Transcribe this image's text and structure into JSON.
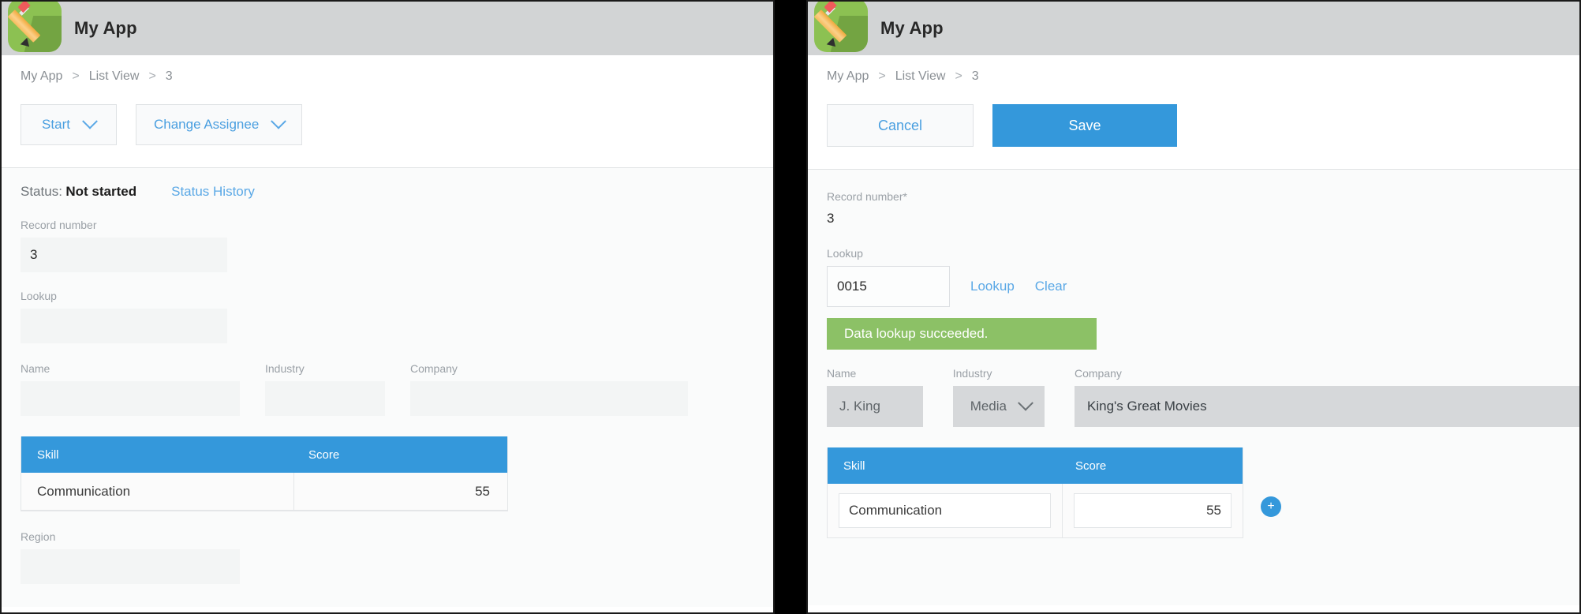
{
  "app": {
    "title": "My App",
    "icon": "pencil-app-icon"
  },
  "breadcrumb": {
    "items": [
      "My App",
      "List View",
      "3"
    ],
    "separator": ">"
  },
  "colors": {
    "accent_blue": "#3498db",
    "link_blue": "#5aa8e6",
    "success_green": "#8cc166",
    "header_gray": "#d2d4d5",
    "field_gray": "#d6d8da",
    "field_flat": "#f3f5f5"
  },
  "left_panel": {
    "toolbar": {
      "start_label": "Start",
      "change_assignee_label": "Change Assignee",
      "chevron_icon": "chevron-down-icon"
    },
    "status": {
      "label": "Status:",
      "value": "Not started",
      "history_link": "Status History"
    },
    "fields": {
      "record_number_label": "Record number",
      "record_number_value": "3",
      "lookup_label": "Lookup",
      "lookup_value": "",
      "name_label": "Name",
      "name_value": "",
      "industry_label": "Industry",
      "industry_value": "",
      "company_label": "Company",
      "company_value": "",
      "region_label": "Region",
      "region_value": ""
    },
    "table": {
      "columns": [
        "Skill",
        "Score"
      ],
      "rows": [
        {
          "skill": "Communication",
          "score": "55"
        }
      ]
    }
  },
  "right_panel": {
    "toolbar": {
      "cancel_label": "Cancel",
      "save_label": "Save"
    },
    "fields": {
      "record_number_label": "Record number",
      "record_number_required": "*",
      "record_number_value": "3",
      "lookup_label": "Lookup",
      "lookup_value": "0015",
      "lookup_button_label": "Lookup",
      "clear_button_label": "Clear",
      "success_message": "Data lookup succeeded.",
      "name_label": "Name",
      "name_value": "J. King",
      "industry_label": "Industry",
      "industry_value": "Media",
      "industry_chevron_icon": "chevron-down-icon",
      "company_label": "Company",
      "company_value": "King's Great Movies"
    },
    "table": {
      "columns": [
        "Skill",
        "Score"
      ],
      "rows": [
        {
          "skill": "Communication",
          "score": "55"
        }
      ],
      "add_row_label": "+"
    }
  }
}
